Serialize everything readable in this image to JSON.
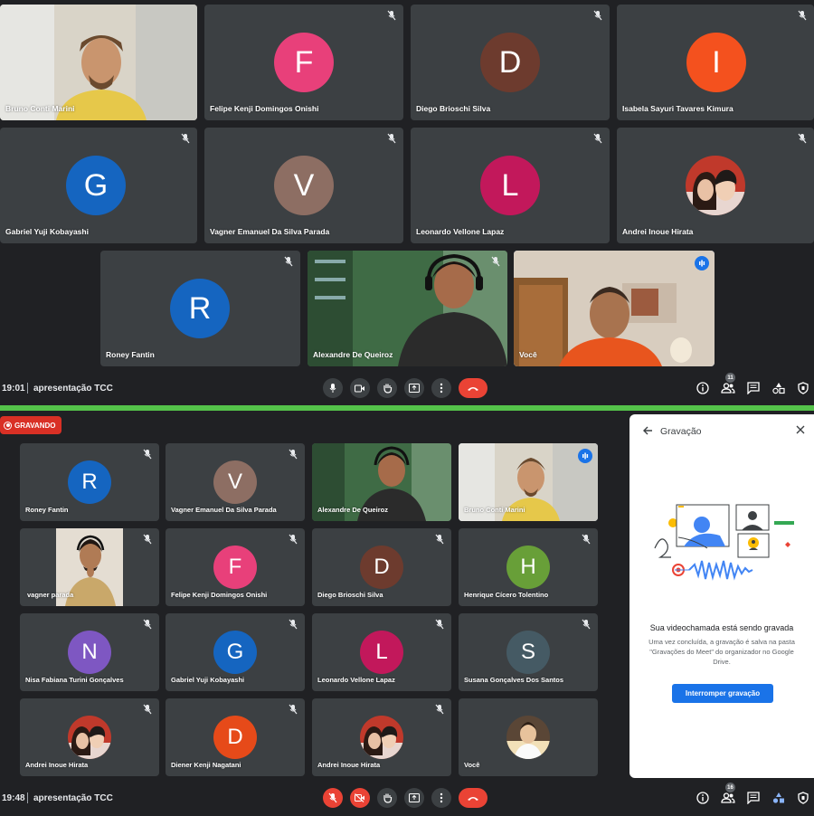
{
  "top": {
    "tiles": [
      {
        "name": "Bruno Conti Marini"
      },
      {
        "name": "Felipe Kenji Domingos Onishi",
        "initial": "F",
        "color": "#e8407a"
      },
      {
        "name": "Diego Brioschi Silva",
        "initial": "D",
        "color": "#6d3b2e"
      },
      {
        "name": "Isabela Sayuri Tavares Kimura",
        "initial": "I",
        "color": "#f4511e"
      },
      {
        "name": "Gabriel Yuji Kobayashi",
        "initial": "G",
        "color": "#1565c0"
      },
      {
        "name": "Vagner Emanuel Da Silva Parada",
        "initial": "V",
        "color": "#8d6e63"
      },
      {
        "name": "Leonardo Vellone Lapaz",
        "initial": "L",
        "color": "#c2185b"
      },
      {
        "name": "Andrei Inoue Hirata"
      },
      {
        "name": "Roney Fantin",
        "initial": "R",
        "color": "#1565c0"
      },
      {
        "name": "Alexandre De Queiroz"
      },
      {
        "name": "Você"
      }
    ],
    "time": "19:01",
    "meeting": "apresentação TCC",
    "participants_count": "11"
  },
  "bottom": {
    "recording_label": "GRAVANDO",
    "tiles": [
      {
        "name": "Roney Fantin",
        "initial": "R",
        "color": "#1565c0"
      },
      {
        "name": "Vagner Emanuel Da Silva Parada",
        "initial": "V",
        "color": "#8d6e63"
      },
      {
        "name": "Alexandre De Queiroz"
      },
      {
        "name": "Bruno Conti Marini"
      },
      {
        "name": "vagner parada"
      },
      {
        "name": "Felipe Kenji Domingos Onishi",
        "initial": "F",
        "color": "#e8407a"
      },
      {
        "name": "Diego Brioschi Silva",
        "initial": "D",
        "color": "#6d3b2e"
      },
      {
        "name": "Henrique Cícero Tolentino",
        "initial": "H",
        "color": "#689f38"
      },
      {
        "name": "Nisa Fabiana Turini Gonçalves",
        "initial": "N",
        "color": "#7e57c2"
      },
      {
        "name": "Gabriel Yuji Kobayashi",
        "initial": "G",
        "color": "#1565c0"
      },
      {
        "name": "Leonardo Vellone Lapaz",
        "initial": "L",
        "color": "#c2185b"
      },
      {
        "name": "Susana Gonçalves Dos Santos",
        "initial": "S",
        "color": "#455a64"
      },
      {
        "name": "Andrei Inoue Hirata"
      },
      {
        "name": "Diener Kenji Nagatani",
        "initial": "D",
        "color": "#e64a19"
      },
      {
        "name": "Andrei Inoue Hirata"
      },
      {
        "name": "Você"
      }
    ],
    "time": "19:48",
    "meeting": "apresentação TCC",
    "participants_count": "16",
    "panel": {
      "title": "Gravação",
      "heading": "Sua videochamada está sendo gravada",
      "description": "Uma vez concluída, a gravação é salva na pasta \"Gravações do Meet\" do organizador no Google Drive.",
      "stop_button": "Interromper gravação"
    }
  }
}
